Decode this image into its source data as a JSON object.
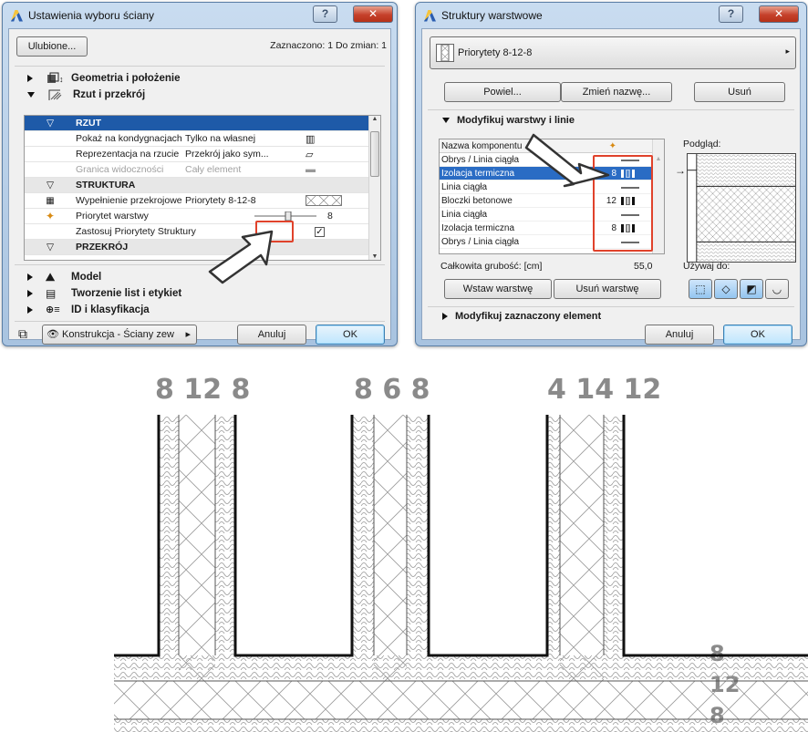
{
  "dialog1": {
    "title": "Ustawienia wyboru ściany",
    "favorites_label": "Ulubione...",
    "selection_info": "Zaznaczono: 1 Do zmian: 1",
    "sections": [
      {
        "label": "Geometria i położenie",
        "expanded": false
      },
      {
        "label": "Rzut i przekrój",
        "expanded": true
      }
    ],
    "grid": {
      "header": "RZUT",
      "rows": [
        {
          "type": "prop",
          "label": "Pokaż na kondygnacjach",
          "value": "Tylko na własnej"
        },
        {
          "type": "prop",
          "label": "Reprezentacja na rzucie",
          "value": "Przekrój jako sym..."
        },
        {
          "type": "prop",
          "label": "Granica widoczności",
          "value": "Cały element",
          "dim": true
        },
        {
          "type": "sub",
          "label": "STRUKTURA"
        },
        {
          "type": "prop",
          "label": "Wypełnienie przekrojowe",
          "value": "Priorytety 8-12-8"
        },
        {
          "type": "prop",
          "label": "Priorytet warstwy",
          "value": "8"
        },
        {
          "type": "prop",
          "label": "Zastosuj Priorytety Struktury",
          "value": ""
        },
        {
          "type": "sub",
          "label": "PRZEKRÓJ"
        }
      ]
    },
    "lower_sections": [
      {
        "label": "Model"
      },
      {
        "label": "Tworzenie list i etykiet"
      },
      {
        "label": "ID i klasyfikacja"
      }
    ],
    "layer_dropdown": "Konstrukcja - Ściany zew",
    "cancel_label": "Anuluj",
    "ok_label": "OK"
  },
  "dialog2": {
    "title": "Struktury warstwowe",
    "structure_name": "Priorytety 8-12-8",
    "duplicate_label": "Powiel...",
    "rename_label": "Zmień nazwę...",
    "delete_label": "Usuń",
    "modify_section": "Modyfikuj warstwy i linie",
    "column_header": "Nazwa komponentu",
    "preview_label": "Podgląd:",
    "layers": [
      {
        "name": "Obrys / Linia ciągła",
        "thickness": "",
        "kind": "line"
      },
      {
        "name": "Izolacja termiczna",
        "thickness": "8",
        "kind": "fill",
        "selected": true
      },
      {
        "name": "Linia ciągła",
        "thickness": "",
        "kind": "line"
      },
      {
        "name": "Bloczki betonowe",
        "thickness": "12",
        "kind": "fill"
      },
      {
        "name": "Linia ciągła",
        "thickness": "",
        "kind": "line"
      },
      {
        "name": "Izolacja termiczna",
        "thickness": "8",
        "kind": "fill"
      },
      {
        "name": "Obrys / Linia ciągła",
        "thickness": "",
        "kind": "line"
      }
    ],
    "total_label": "Całkowita grubość: [cm]",
    "total_value": "55,0",
    "used_for_label": "Używaj do:",
    "insert_layer_label": "Wstaw warstwę",
    "delete_layer_label": "Usuń warstwę",
    "modify_selected_section": "Modyfikuj zaznaczony element",
    "cancel_label": "Anuluj",
    "ok_label": "OK"
  },
  "drawing": {
    "dims_top": [
      [
        "8",
        "12",
        "8"
      ],
      [
        "8",
        "6",
        "8"
      ],
      [
        "4",
        "14",
        "12"
      ]
    ],
    "dims_right": [
      "8",
      "12",
      "8"
    ]
  },
  "colors": {
    "selection": "#2a6cc4",
    "grid_header": "#1e5aa8",
    "callout": "#e0422b"
  }
}
